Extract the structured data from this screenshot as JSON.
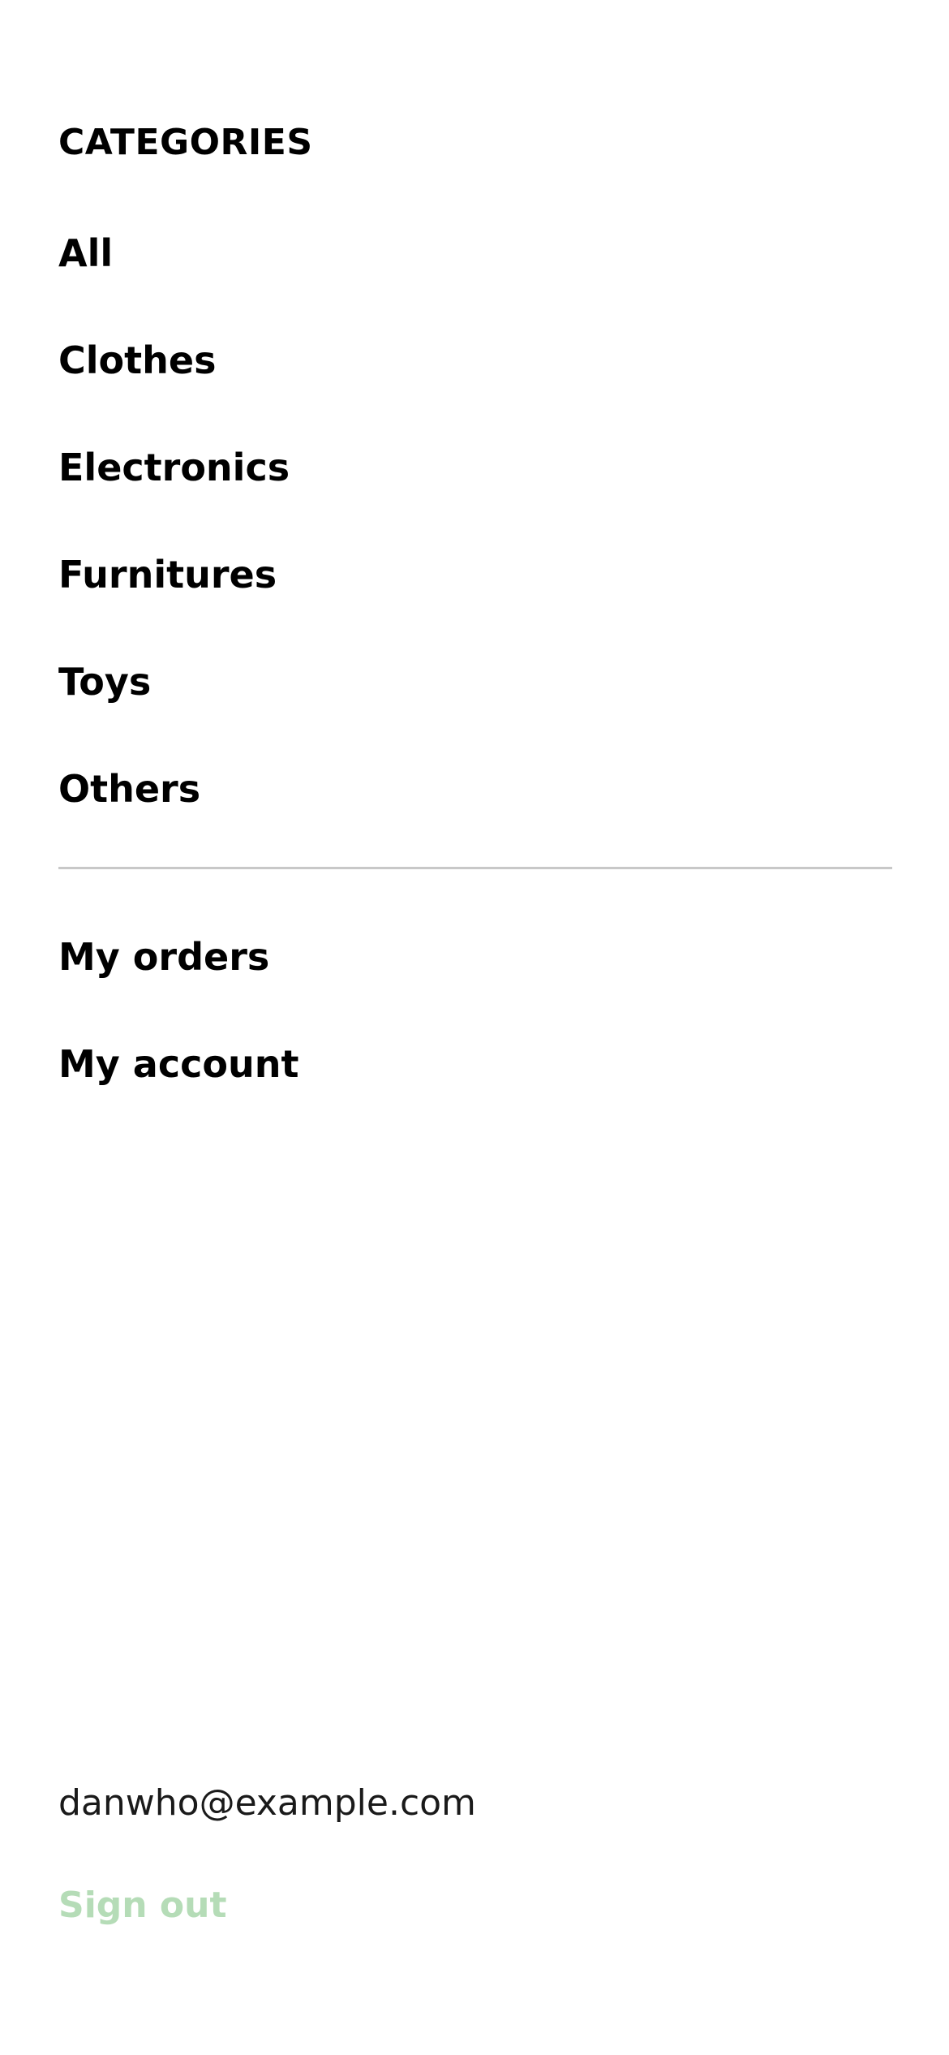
{
  "menu": {
    "categories_title": "CATEGORIES",
    "categories": [
      {
        "label": "All"
      },
      {
        "label": "Clothes"
      },
      {
        "label": "Electronics"
      },
      {
        "label": "Furnitures"
      },
      {
        "label": "Toys"
      },
      {
        "label": "Others"
      }
    ],
    "account_links": [
      {
        "label": "My orders"
      },
      {
        "label": "My account"
      }
    ]
  },
  "user": {
    "email": "danwho@example.com",
    "sign_out_label": "Sign out"
  },
  "colors": {
    "text": "#000000",
    "divider": "#c8c8c8",
    "sign_out": "#b5dcb7",
    "background": "#ffffff"
  }
}
